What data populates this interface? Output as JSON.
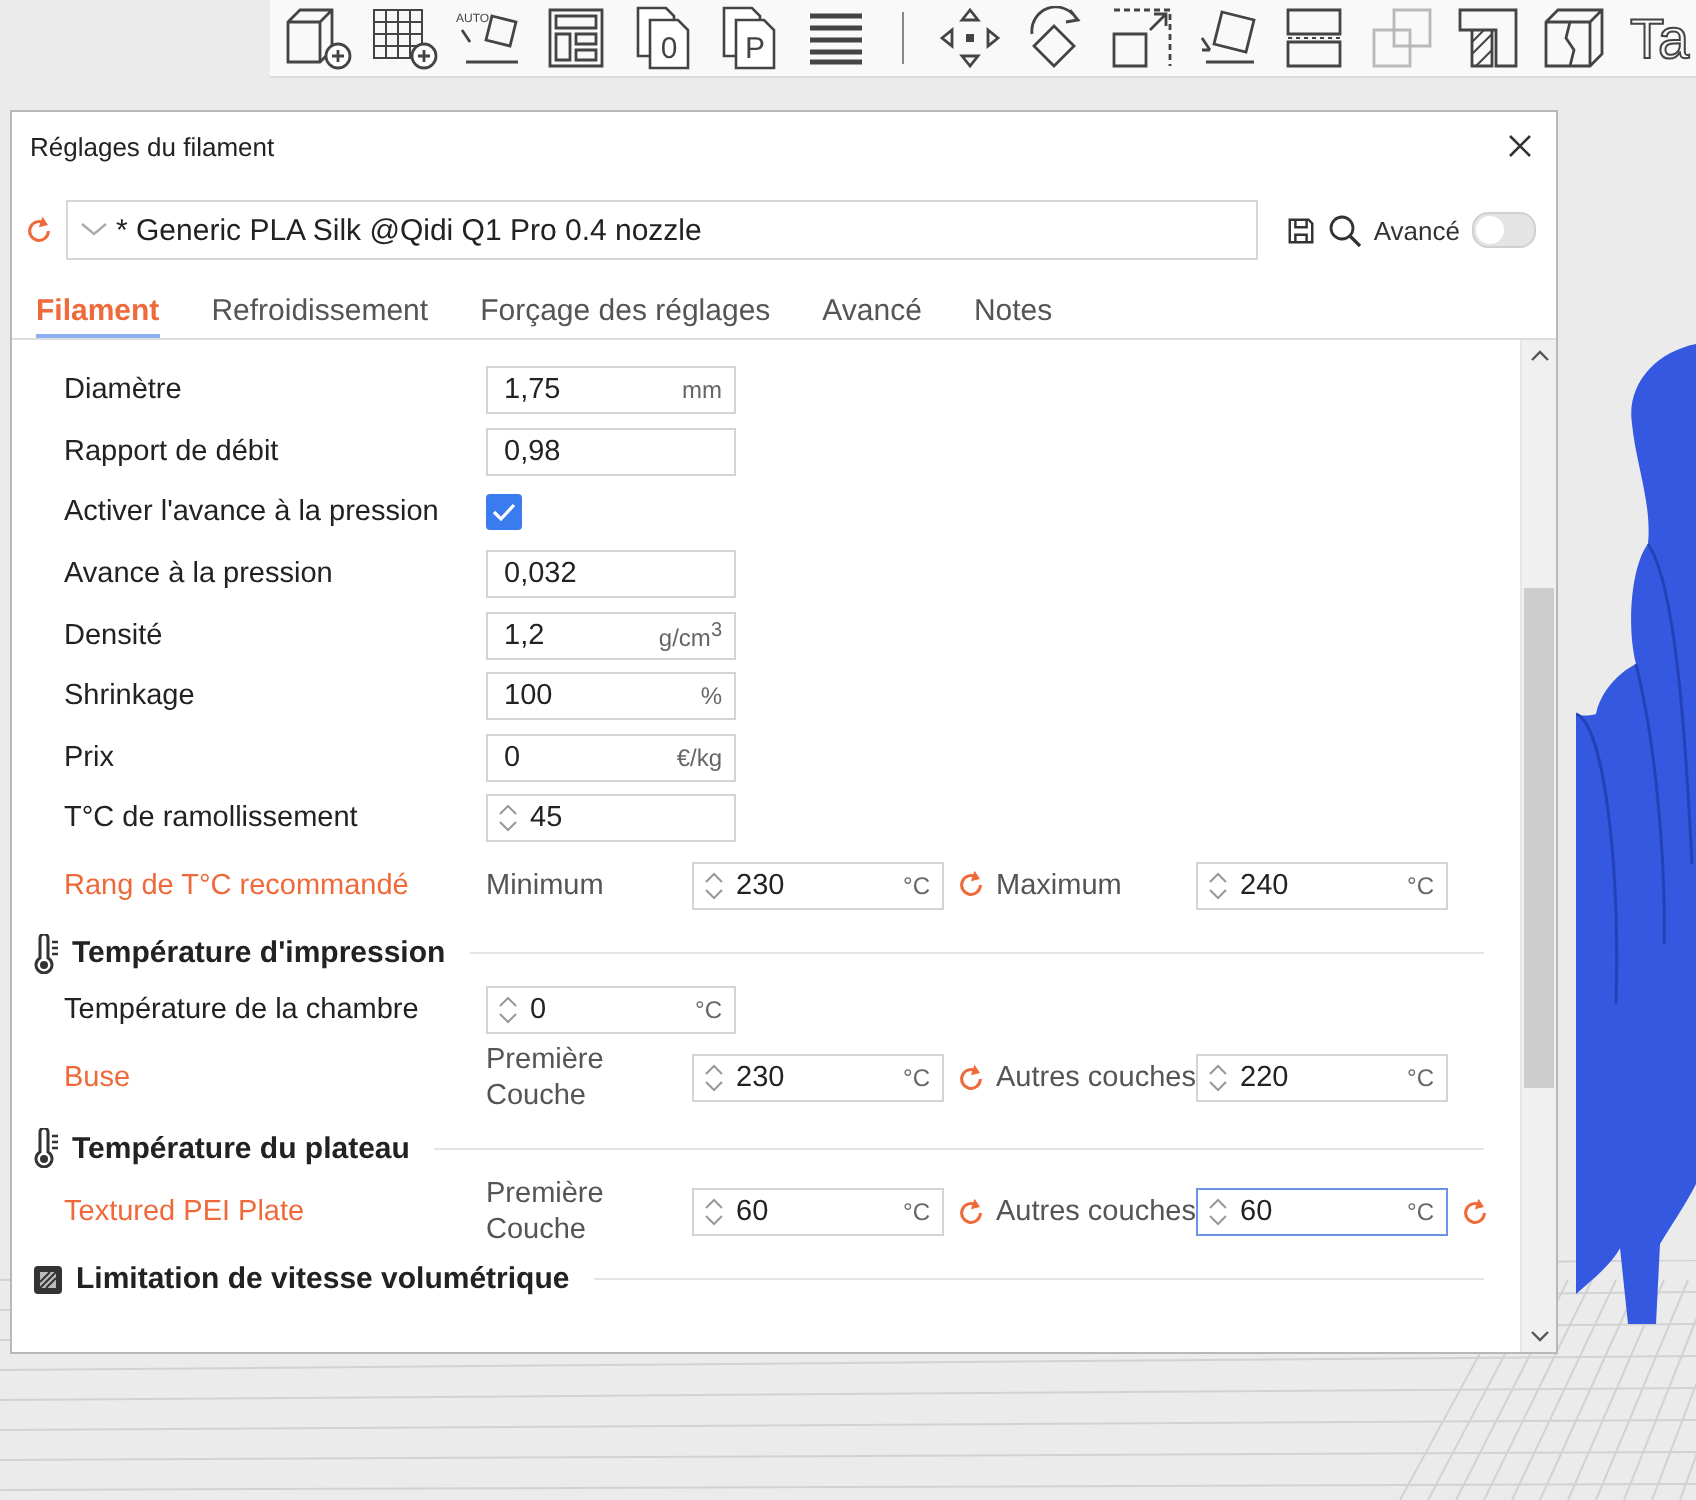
{
  "toolbar": [
    {
      "kind": "add-cube"
    },
    {
      "kind": "add-grid"
    },
    {
      "kind": "auto-orient",
      "glyph": "AUTO"
    },
    {
      "kind": "layout"
    },
    {
      "kind": "page",
      "glyph": "0"
    },
    {
      "kind": "page",
      "glyph": "P"
    },
    {
      "kind": "lines"
    },
    {
      "kind": "separator"
    },
    {
      "kind": "move"
    },
    {
      "kind": "rotate"
    },
    {
      "kind": "scale"
    },
    {
      "kind": "lay-flat"
    },
    {
      "kind": "cut"
    },
    {
      "kind": "boolean",
      "disabled": true
    },
    {
      "kind": "support-paint"
    },
    {
      "kind": "seam-paint"
    },
    {
      "kind": "text",
      "glyph": "Ta"
    }
  ],
  "dialog": {
    "title": "Réglages du filament",
    "preset": {
      "value": "* Generic PLA Silk @Qidi Q1 Pro 0.4 nozzle"
    },
    "advanced": {
      "label": "Avancé",
      "on": false
    },
    "tabs": [
      {
        "label": "Filament",
        "selected": true
      },
      {
        "label": "Refroidissement",
        "selected": false
      },
      {
        "label": "Forçage des réglages",
        "selected": false
      },
      {
        "label": "Avancé",
        "selected": false
      },
      {
        "label": "Notes",
        "selected": false
      }
    ],
    "sections": [
      {
        "rows": [
          {
            "kind": "field",
            "label": "Diamètre",
            "value": "1,75",
            "unit": "mm"
          },
          {
            "kind": "field",
            "label": "Rapport de débit",
            "value": "0,98"
          },
          {
            "kind": "checkbox",
            "label": "Activer l'avance à la pression",
            "checked": true
          },
          {
            "kind": "field",
            "label": "Avance à la pression",
            "value": "0,032"
          },
          {
            "kind": "field",
            "label": "Densité",
            "value": "1,2",
            "unit": "g/cm$^{3}$"
          },
          {
            "kind": "field",
            "label": "Shrinkage",
            "value": "100",
            "unit": "%"
          },
          {
            "kind": "field",
            "label": "Prix",
            "value": "0",
            "unit": "€/kg"
          },
          {
            "kind": "spin",
            "label": "T°C de ramollissement",
            "value": "45"
          },
          {
            "kind": "pair",
            "label": "Rang de T°C recommandé",
            "modified": true,
            "fields": [
              {
                "label": "Minimum",
                "value": "230",
                "unit": "°C",
                "reset": true,
                "focused": false
              },
              {
                "label": "Maximum",
                "value": "240",
                "unit": "°C",
                "reset": false,
                "focused": false
              }
            ]
          }
        ]
      },
      {
        "title": "Température d'impression",
        "kind": "thermometer",
        "rows": [
          {
            "kind": "spin",
            "label": "Température de la chambre",
            "value": "0",
            "unit": "°C"
          },
          {
            "kind": "pair",
            "label": "Buse",
            "modified": true,
            "fields": [
              {
                "label": "Première Couche",
                "value": "230",
                "unit": "°C",
                "reset": true,
                "focused": false
              },
              {
                "label": "Autres couches",
                "value": "220",
                "unit": "°C",
                "reset": false,
                "focused": false
              }
            ]
          }
        ]
      },
      {
        "title": "Température du plateau",
        "kind": "thermometer",
        "rows": [
          {
            "kind": "pair",
            "label": "Textured PEI Plate",
            "modified": true,
            "fields": [
              {
                "label": "Première Couche",
                "value": "60",
                "unit": "°C",
                "reset": true,
                "focused": false
              },
              {
                "label": "Autres couches",
                "value": "60",
                "unit": "°C",
                "reset": true,
                "focused": true
              }
            ]
          }
        ]
      },
      {
        "title": "Limitation de vitesse volumétrique",
        "kind": "speed"
      }
    ]
  }
}
